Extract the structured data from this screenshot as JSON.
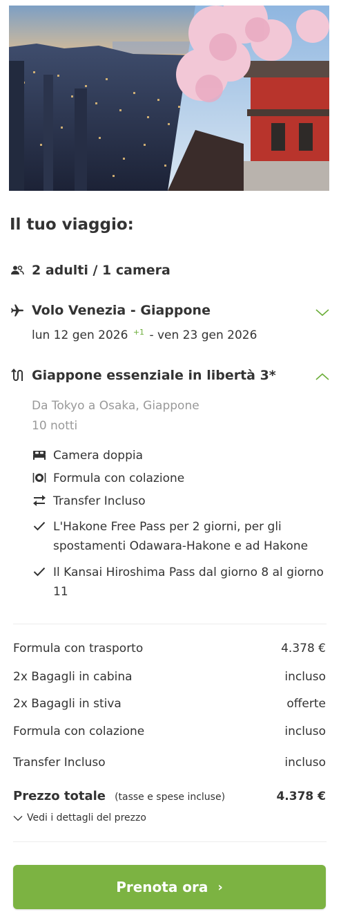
{
  "hero": {
    "image": "tokyo-skyline-and-cherry-blossom-temple"
  },
  "trip": {
    "title": "Il tuo viaggio:",
    "guests": "2 adulti / 1 camera",
    "flight": {
      "label": "Volo Venezia - Giappone",
      "depart": "lun 12 gen 2026",
      "plus_days": "+1",
      "return": "- ven 23 gen 2026"
    },
    "package": {
      "label": "Giappone essenziale in libertà 3*",
      "route": "Da Tokyo a Osaka, Giappone",
      "nights": "10 notti",
      "features": [
        {
          "icon": "bed-icon",
          "text": "Camera doppia"
        },
        {
          "icon": "plate-icon",
          "text": "Formula con colazione"
        },
        {
          "icon": "transfer-icon",
          "text": "Transfer Incluso"
        },
        {
          "icon": "check-icon",
          "text": "L'Hakone Free Pass per 2 giorni, per gli spostamenti Odawara-Hakone e ad Hakone"
        },
        {
          "icon": "check-icon",
          "text": "Il Kansai Hiroshima Pass dal giorno 8 al giorno 11"
        }
      ]
    }
  },
  "pricing": {
    "rows": [
      {
        "label": "Formula con trasporto",
        "value": "4.378 €"
      },
      {
        "label": "2x Bagagli in cabina",
        "value": "incluso"
      },
      {
        "label": "2x Bagagli in stiva",
        "value": "offerte"
      },
      {
        "label": "Formula con colazione",
        "value": "incluso"
      },
      {
        "label": "Transfer Incluso",
        "value": "incluso"
      }
    ],
    "total_label": "Prezzo totale",
    "total_note": "(tasse e spese incluse)",
    "total_value": "4.378 €",
    "details_link": "Vedi i dettagli del prezzo"
  },
  "cta": {
    "label": "Prenota ora",
    "arrow": "›"
  },
  "colors": {
    "accent": "#7cb342",
    "chevron": "#6cae3a",
    "muted": "#999999"
  }
}
